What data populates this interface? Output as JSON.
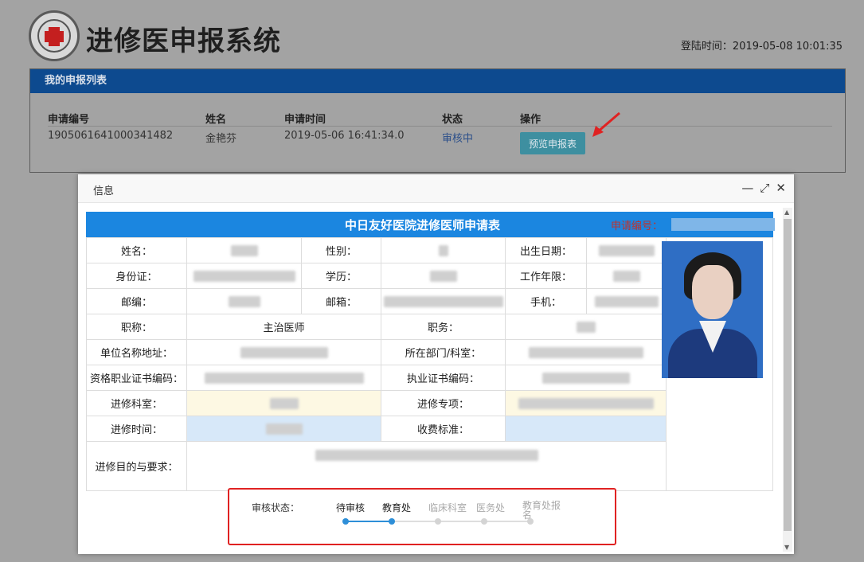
{
  "header": {
    "app_title": "进修医申报系统",
    "login_time": "登陆时间：2019-05-08 10:01:35"
  },
  "list": {
    "title": "我的申报列表",
    "columns": [
      "申请编号",
      "姓名",
      "申请时间",
      "状态",
      "操作"
    ],
    "rows": [
      {
        "id": "1905061641000341482",
        "name": "金艳芬",
        "time": "2019-05-06 16:41:34.0",
        "status": "审核中",
        "action": "预览申报表"
      }
    ]
  },
  "dialog": {
    "title": "信息",
    "controls": {
      "minimize": "—",
      "maximize": "⤢",
      "close": "✕"
    },
    "form_title": "中日友好医院进修医师申请表",
    "app_no_label": "申请编号：",
    "fields": {
      "name": "姓名：",
      "gender": "性别：",
      "birth": "出生日期：",
      "id_card": "身份证：",
      "education": "学历：",
      "work_years": "工作年限：",
      "postcode": "邮编：",
      "email": "邮箱：",
      "phone": "手机：",
      "title": "职称：",
      "title_value": "主治医师",
      "position": "职务：",
      "unit_address": "单位名称地址：",
      "department": "所在部门/科室：",
      "qual_cert": "资格职业证书编码：",
      "license_cert": "执业证书编码：",
      "study_dept": "进修科室：",
      "study_major": "进修专项：",
      "study_time": "进修时间：",
      "fee": "收费标准：",
      "purpose": "进修目的与要求："
    },
    "audit": {
      "label": "审核状态：",
      "steps": [
        {
          "name": "待审核",
          "state": "done"
        },
        {
          "name": "教育处",
          "state": "done"
        },
        {
          "name": "临床科室",
          "state": "todo"
        },
        {
          "name": "医务处",
          "state": "todo"
        },
        {
          "name": "教育处报名",
          "state": "todo"
        }
      ]
    }
  },
  "colors": {
    "header_blue": "#0d4a8f",
    "form_head_blue": "#1b86e0",
    "button_teal": "#3e8fa0",
    "highlight_red": "#e02222",
    "step_done": "#2e8fd8"
  }
}
